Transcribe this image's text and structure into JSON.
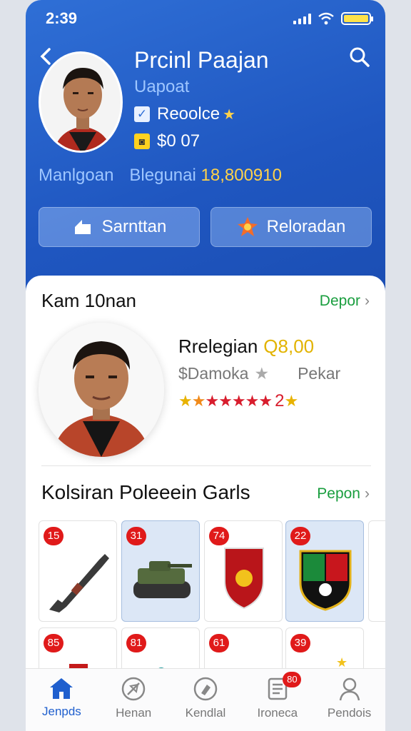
{
  "status": {
    "time": "2:39"
  },
  "header": {
    "back_icon": "chevron-left-icon",
    "search_icon": "search-icon",
    "name": "Prcinl Paajan",
    "subname": "Uapoat",
    "role": "Reoolce",
    "balance": "$0 07",
    "stat_label_1": "Manlgoan",
    "stat_label_2": "Blegunai",
    "stat_value": "18,800910"
  },
  "actions": {
    "primary_label": "Sarnttan",
    "secondary_label": "Reloradan"
  },
  "featured": {
    "title": "Kam 10nan",
    "link": "Depor",
    "name": "Rrelegian",
    "price": "Q8,00",
    "sub": "$Damoka",
    "sub_right": "Pekar",
    "rating_count": "2"
  },
  "collection": {
    "title": "Kolsiran Poleeein Garls",
    "link": "Pepon",
    "items_row1": [
      {
        "badge": "15",
        "icon": "rifle-icon"
      },
      {
        "badge": "31",
        "icon": "tank-icon"
      },
      {
        "badge": "74",
        "icon": "shield-crest-icon"
      },
      {
        "badge": "22",
        "icon": "team-badge-icon"
      }
    ],
    "items_row2": [
      {
        "badge": "85",
        "icon": "figure-icon"
      },
      {
        "badge": "81",
        "icon": "vehicle-icon"
      },
      {
        "badge": "61",
        "icon": "gear-part-icon"
      },
      {
        "badge": "39",
        "icon": "shield-star-icon"
      }
    ]
  },
  "nav": {
    "items": [
      {
        "label": "Jenpds",
        "icon": "home-icon"
      },
      {
        "label": "Henan",
        "icon": "compass-icon"
      },
      {
        "label": "Kendlal",
        "icon": "pin-icon"
      },
      {
        "label": "Ironeca",
        "icon": "list-icon",
        "badge": "80"
      },
      {
        "label": "Pendois",
        "icon": "profile-icon"
      }
    ]
  },
  "colors": {
    "primary": "#2f6fd6",
    "accent_gold": "#ffd24a",
    "badge_red": "#e01a1a",
    "link_green": "#1a9e3f"
  }
}
